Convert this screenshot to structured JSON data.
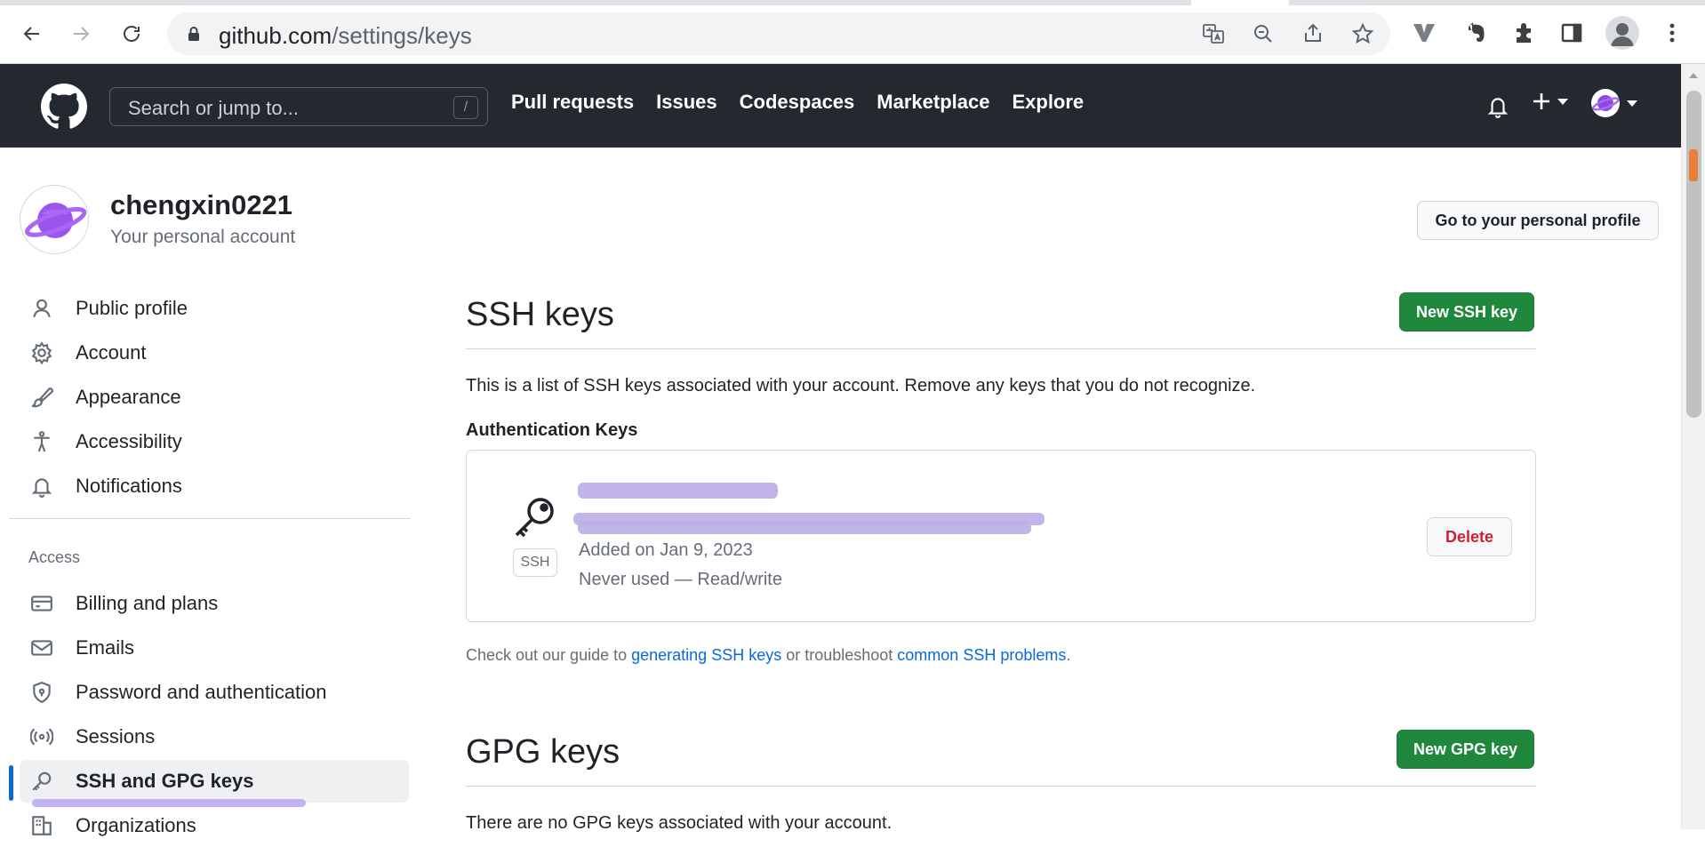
{
  "browser": {
    "url_host": "github.com",
    "url_path": "/settings/keys"
  },
  "gh_header": {
    "search_placeholder": "Search or jump to...",
    "search_shortcut": "/",
    "nav": [
      "Pull requests",
      "Issues",
      "Codespaces",
      "Marketplace",
      "Explore"
    ]
  },
  "account": {
    "username": "chengxin0221",
    "subtitle": "Your personal account",
    "profile_button": "Go to your personal profile"
  },
  "sidebar": {
    "items": [
      {
        "label": "Public profile",
        "icon": "person-icon"
      },
      {
        "label": "Account",
        "icon": "gear-icon"
      },
      {
        "label": "Appearance",
        "icon": "paintbrush-icon"
      },
      {
        "label": "Accessibility",
        "icon": "accessibility-icon"
      },
      {
        "label": "Notifications",
        "icon": "bell-icon"
      }
    ],
    "access_heading": "Access",
    "access_items": [
      {
        "label": "Billing and plans",
        "icon": "credit-card-icon"
      },
      {
        "label": "Emails",
        "icon": "mail-icon"
      },
      {
        "label": "Password and authentication",
        "icon": "shield-lock-icon"
      },
      {
        "label": "Sessions",
        "icon": "broadcast-icon"
      },
      {
        "label": "SSH and GPG keys",
        "icon": "key-icon",
        "active": true
      },
      {
        "label": "Organizations",
        "icon": "organization-icon"
      }
    ]
  },
  "ssh": {
    "title": "SSH keys",
    "new_button": "New SSH key",
    "description": "This is a list of SSH keys associated with your account. Remove any keys that you do not recognize.",
    "auth_heading": "Authentication Keys",
    "key": {
      "badge": "SSH",
      "added": "Added on Jan 9, 2023",
      "usage": "Never used — Read/write",
      "delete_button": "Delete"
    },
    "guide_prefix": "Check out our guide to ",
    "guide_link1": "generating SSH keys",
    "guide_middle": " or troubleshoot ",
    "guide_link2": "common SSH problems",
    "guide_suffix": "."
  },
  "gpg": {
    "title": "GPG keys",
    "new_button": "New GPG key",
    "description": "There are no GPG keys associated with your account."
  },
  "colors": {
    "header_bg": "#24292f",
    "primary_green": "#1f883d",
    "link_blue": "#0969da",
    "danger_red": "#cf222e",
    "redaction_purple": "#bdb0e8"
  }
}
